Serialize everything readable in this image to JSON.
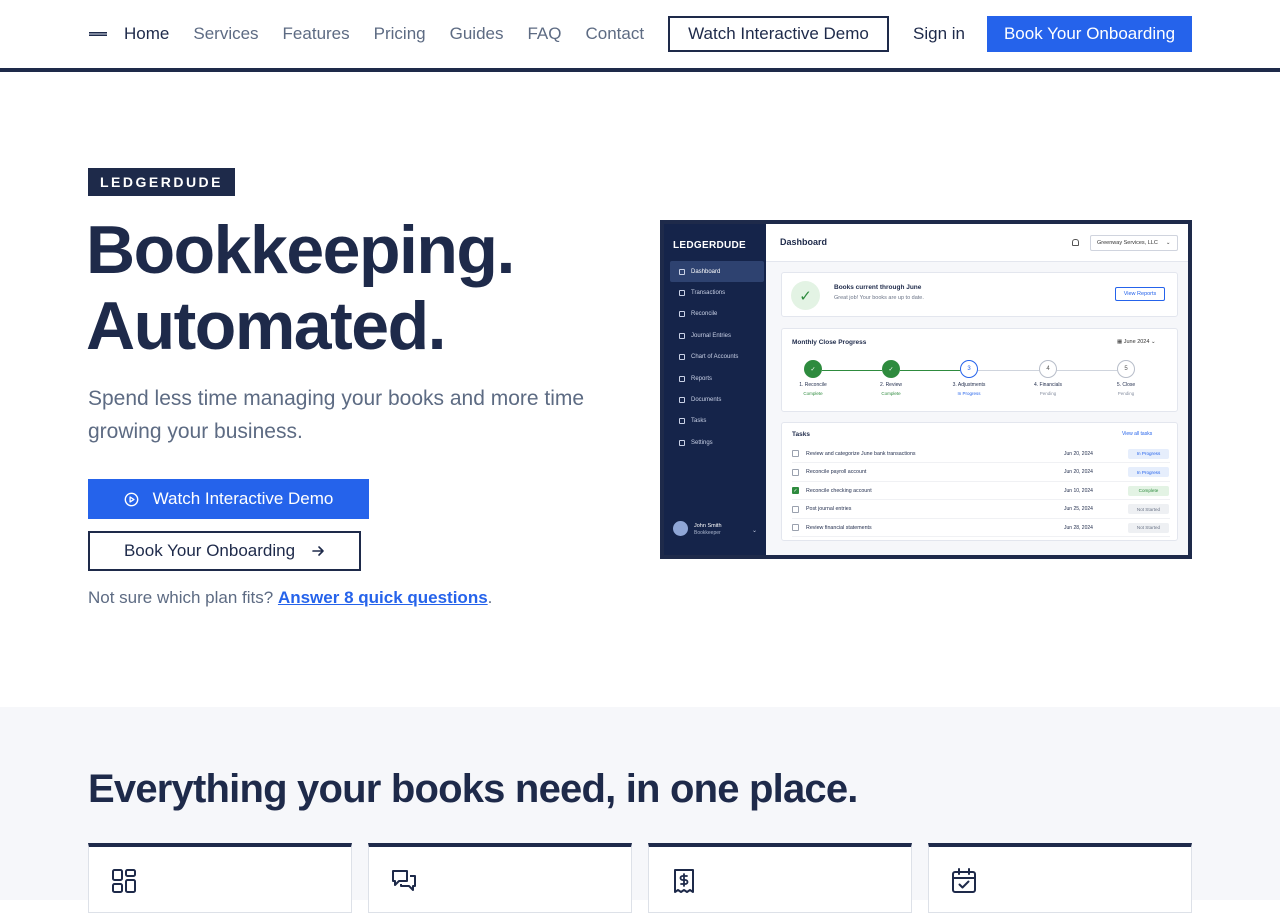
{
  "nav": {
    "items": [
      {
        "label": "Home",
        "active": true
      },
      {
        "label": "Services"
      },
      {
        "label": "Features"
      },
      {
        "label": "Pricing"
      },
      {
        "label": "Guides"
      },
      {
        "label": "FAQ"
      },
      {
        "label": "Contact"
      }
    ],
    "demo_label": "Watch Interactive Demo",
    "signin_label": "Sign in",
    "onboard_label": "Book Your Onboarding"
  },
  "hero": {
    "eyebrow": "LEDGERDUDE",
    "title_line1": "Bookkeeping.",
    "title_line2": "Automated.",
    "subtitle": "Spend less time managing your books and more time growing your business.",
    "demo_label": "Watch Interactive Demo",
    "onboard_label": "Book Your Onboarding",
    "plan_prefix": "Not sure which plan fits?",
    "plan_link": "Answer 8 quick questions",
    "plan_suffix": "."
  },
  "dashboard": {
    "brand": "LEDGERDUDE",
    "title": "Dashboard",
    "company": "Greenway Services, LLC",
    "menu": [
      "Dashboard",
      "Transactions",
      "Reconcile",
      "Journal Entries",
      "Chart of Accounts",
      "Reports",
      "Documents",
      "Tasks",
      "Settings"
    ],
    "user_name": "John Smith",
    "user_role": "Bookkeeper",
    "status_title": "Books current through June",
    "status_sub": "Great job! Your books are up to date.",
    "status_button": "View Reports",
    "close_title": "Monthly Close Progress",
    "close_month": "June 2024",
    "steps": [
      {
        "num": "✓",
        "name": "1. Reconcile",
        "status": "Complete",
        "state": "complete"
      },
      {
        "num": "✓",
        "name": "2. Review",
        "status": "Complete",
        "state": "complete"
      },
      {
        "num": "3",
        "name": "3. Adjustments",
        "status": "In Progress",
        "state": "progress"
      },
      {
        "num": "4",
        "name": "4. Financials",
        "status": "Pending",
        "state": "pending"
      },
      {
        "num": "5",
        "name": "5. Close",
        "status": "Pending",
        "state": "pending"
      }
    ],
    "tasks_title": "Tasks",
    "tasks_link": "View all tasks",
    "tasks": [
      {
        "name": "Review and categorize June bank transactions",
        "date": "Jun 20, 2024",
        "status": "In Progress",
        "state": "progress",
        "checked": false
      },
      {
        "name": "Reconcile payroll account",
        "date": "Jun 20, 2024",
        "status": "In Progress",
        "state": "progress",
        "checked": false
      },
      {
        "name": "Reconcile checking account",
        "date": "Jun 10, 2024",
        "status": "Complete",
        "state": "complete",
        "checked": true
      },
      {
        "name": "Post journal entries",
        "date": "Jun 25, 2024",
        "status": "Not Started",
        "state": "pending",
        "checked": false
      },
      {
        "name": "Review financial statements",
        "date": "Jun 28, 2024",
        "status": "Not Started",
        "state": "pending",
        "checked": false
      }
    ]
  },
  "features": {
    "title": "Everything your books need, in one place.",
    "cards": [
      {
        "icon": "dashboard-grid-icon"
      },
      {
        "icon": "chat-bubbles-icon"
      },
      {
        "icon": "receipt-dollar-icon"
      },
      {
        "icon": "calendar-check-icon"
      }
    ]
  },
  "colors": {
    "navy": "#1e2a4a",
    "primary": "#2563eb",
    "muted": "#5d6b83",
    "section_bg": "#f6f7fa",
    "success": "#2e8b3e"
  }
}
